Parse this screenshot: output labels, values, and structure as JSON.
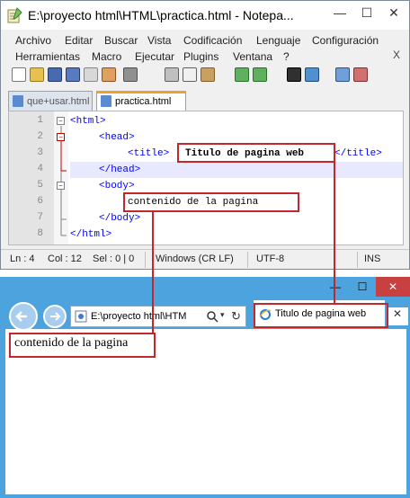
{
  "notepad": {
    "title": "E:\\proyecto html\\HTML\\practica.html - Notepa...",
    "controls": {
      "minimize": "—",
      "maximize": "☐",
      "close": "✕"
    },
    "menu_row1": [
      "Archivo",
      "Editar",
      "Buscar",
      "Vista",
      "Codificación",
      "Lenguaje",
      "Configuración"
    ],
    "menu_row2": [
      "Herramientas",
      "Macro",
      "Ejecutar",
      "Plugins",
      "Ventana",
      "?"
    ],
    "menu_close": "X",
    "tabs": [
      "que+usar.html",
      "practica.html"
    ],
    "line_numbers": [
      "1",
      "2",
      "3",
      "4",
      "5",
      "6",
      "7",
      "8"
    ],
    "code": {
      "l1": "<html>",
      "l2": "<head>",
      "l3_open": "<title>",
      "l3_text": "Titulo de pagina web",
      "l3_close": "</title>",
      "l4": "</head>",
      "l5": "<body>",
      "l6": "contenido de la pagina",
      "l7": "</body>",
      "l8": "</html>"
    },
    "status": {
      "ln": "Ln : 4",
      "col": "Col : 12",
      "sel": "Sel : 0 | 0",
      "eol": "Windows (CR LF)",
      "enc": "UTF-8",
      "ins": "INS"
    },
    "toolbar_icons": [
      "new-file-icon",
      "open-file-icon",
      "save-icon",
      "save-all-icon",
      "close-icon",
      "close-all-icon",
      "print-icon",
      "cut-icon",
      "copy-icon",
      "paste-icon",
      "undo-icon",
      "redo-icon",
      "find-icon",
      "replace-icon",
      "zoom-in-icon",
      "zoom-out-icon"
    ]
  },
  "browser": {
    "controls": {
      "minimize": "—",
      "maximize": "☐",
      "close": "✕"
    },
    "address": "E:\\proyecto html\\HTM",
    "tab_title": "Titulo de pagina web",
    "tab_close": "✕",
    "page_body": "contenido de la pagina"
  },
  "colors": {
    "annotation": "#c0282e",
    "ie_frame": "#4da3de",
    "tag_blue": "#0000ff",
    "tab_accent": "#f0a030"
  }
}
